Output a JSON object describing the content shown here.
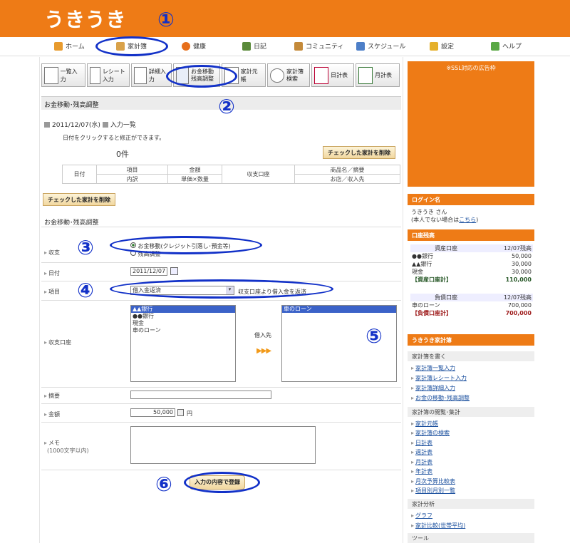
{
  "logo": "うきうき",
  "nav": [
    {
      "label": "ホーム"
    },
    {
      "label": "家計簿"
    },
    {
      "label": "健康"
    },
    {
      "label": "日記"
    },
    {
      "label": "コミュニティ"
    },
    {
      "label": "スケジュール"
    },
    {
      "label": "設定"
    },
    {
      "label": "ヘルプ"
    }
  ],
  "tools": [
    {
      "label": "一覧入力"
    },
    {
      "label": "レシート入力"
    },
    {
      "label": "詳細入力"
    },
    {
      "label": "お金移動\n残高調整"
    },
    {
      "label": "家計元帳"
    },
    {
      "label": "家計簿\n検索"
    },
    {
      "label": "日計表"
    },
    {
      "label": "月計表"
    }
  ],
  "section_title": "お金移動･残高調整",
  "date_line": "2011/12/07(水)",
  "list_label": "入力一覧",
  "hint": "日付をクリックすると修正ができます。",
  "count": "0件",
  "delete_btn": "チェックした家計を削除",
  "table_headers": {
    "date": "日付",
    "item": "項目",
    "breakdown": "内訳",
    "amount": "金額",
    "unit": "単価×数量",
    "account": "収支口座",
    "product": "商品名／摘要",
    "shop": "お店／収入先"
  },
  "form_title": "お金移動･残高調整",
  "form": {
    "shushi_label": "収支",
    "radio1": "お金移動(クレジット引落し･預金等)",
    "radio2": "残高調整",
    "date_label": "日付",
    "date_value": "2011/12/07",
    "item_label": "項目",
    "item_value": "借入金返済",
    "item_desc": "収支口座より借入金を返済",
    "account_label": "収支口座",
    "accounts_left": [
      "▲▲銀行",
      "●●銀行",
      "現金",
      "車のローン"
    ],
    "transfer_label": "借入先",
    "accounts_right": [
      "車のローン"
    ],
    "summary_label": "摘要",
    "amount_label": "金額",
    "amount_value": "50,000",
    "yen": "円",
    "memo_label": "メモ",
    "memo_hint": "(1000文字以内)",
    "submit": "入力の内容で登録"
  },
  "annotations": [
    "①",
    "②",
    "③",
    "④",
    "⑤",
    "⑥"
  ],
  "ad": "※SSL対応の広告枠",
  "login": {
    "head": "ログイン名",
    "name": "うきうき さん",
    "note": "(本人でない場合は",
    "link": "こちら",
    "close": ")"
  },
  "balance": {
    "head": "口座残高",
    "asset_title": "資産口座",
    "asset_date": "12/07残高",
    "assets": [
      {
        "name": "●●銀行",
        "value": "50,000"
      },
      {
        "name": "▲▲銀行",
        "value": "30,000"
      },
      {
        "name": "現金",
        "value": "30,000"
      }
    ],
    "asset_total_label": "【資産口座計】",
    "asset_total": "110,000",
    "debt_title": "負債口座",
    "debt_date": "12/07残高",
    "debts": [
      {
        "name": "車のローン",
        "value": "700,000"
      }
    ],
    "debt_total_label": "【負債口座計】",
    "debt_total": "700,000"
  },
  "kakeibo": {
    "head": "うきうき家計簿",
    "write": "家計簿を書く",
    "write_links": [
      "家計簿一覧入力",
      "家計簿レシート入力",
      "家計簿詳細入力",
      "お金の移動･残高調整"
    ],
    "view": "家計簿の閲覧･集計",
    "view_links": [
      "家計元帳",
      "家計簿の検索",
      "日計表",
      "週計表",
      "月計表",
      "年計表",
      "月次予算比較表",
      "項目別月別一覧"
    ],
    "analysis": "家計分析",
    "analysis_links": [
      "グラフ",
      "家計比較(世帯平均)"
    ],
    "tools": "ツール"
  },
  "colors": {
    "orange": "#ee7b16",
    "annotation": "#1231c8"
  }
}
